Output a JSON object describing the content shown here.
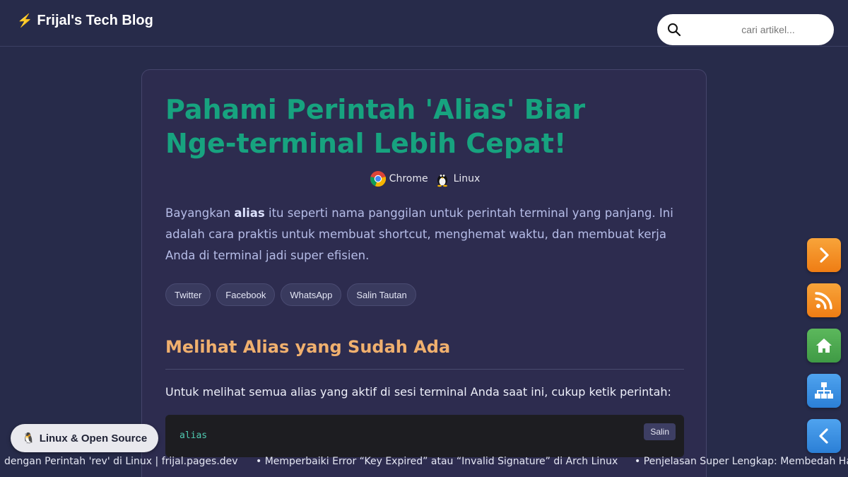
{
  "header": {
    "brand": "Frijal's Tech Blog",
    "search_placeholder": "cari artikel..."
  },
  "article": {
    "title": "Pahami Perintah 'Alias' Biar Nge-terminal Lebih Cepat!",
    "platforms": [
      {
        "label": "Chrome",
        "icon": "chrome-icon"
      },
      {
        "label": "Linux",
        "icon": "tux-icon"
      }
    ],
    "intro_before": "Bayangkan ",
    "intro_bold": "alias",
    "intro_after": " itu seperti nama panggilan untuk perintah terminal yang panjang. Ini adalah cara praktis untuk membuat shortcut, menghemat waktu, dan membuat kerja Anda di terminal jadi super efisien.",
    "share": [
      "Twitter",
      "Facebook",
      "WhatsApp",
      "Salin Tautan"
    ],
    "section_heading": "Melihat Alias yang Sudah Ada",
    "section_paragraph": "Untuk melihat semua alias yang aktif di sesi terminal Anda saat ini, cukup ketik perintah:",
    "code": "alias",
    "copy_label": "Salin"
  },
  "category": {
    "label": "Linux & Open Source",
    "icon": "penguin-emoji"
  },
  "ticker": [
    "dengan Perintah 'rev' di Linux | frijal.pages.dev",
    "• Memperbaiki Error “Key Expired” atau “Invalid Signature” di Arch Linux",
    "• Penjelasan Super Lengkap: Membedah Has"
  ],
  "floating_buttons": [
    "next-icon",
    "rss-icon",
    "home-icon",
    "sitemap-icon",
    "prev-icon"
  ],
  "colors": {
    "background": "#272b4a",
    "card": "#2d2c4f",
    "title": "#17a37f",
    "heading": "#f0b06e",
    "orange": "#f08c20",
    "green": "#4caf50",
    "blue": "#3a8fe3"
  }
}
